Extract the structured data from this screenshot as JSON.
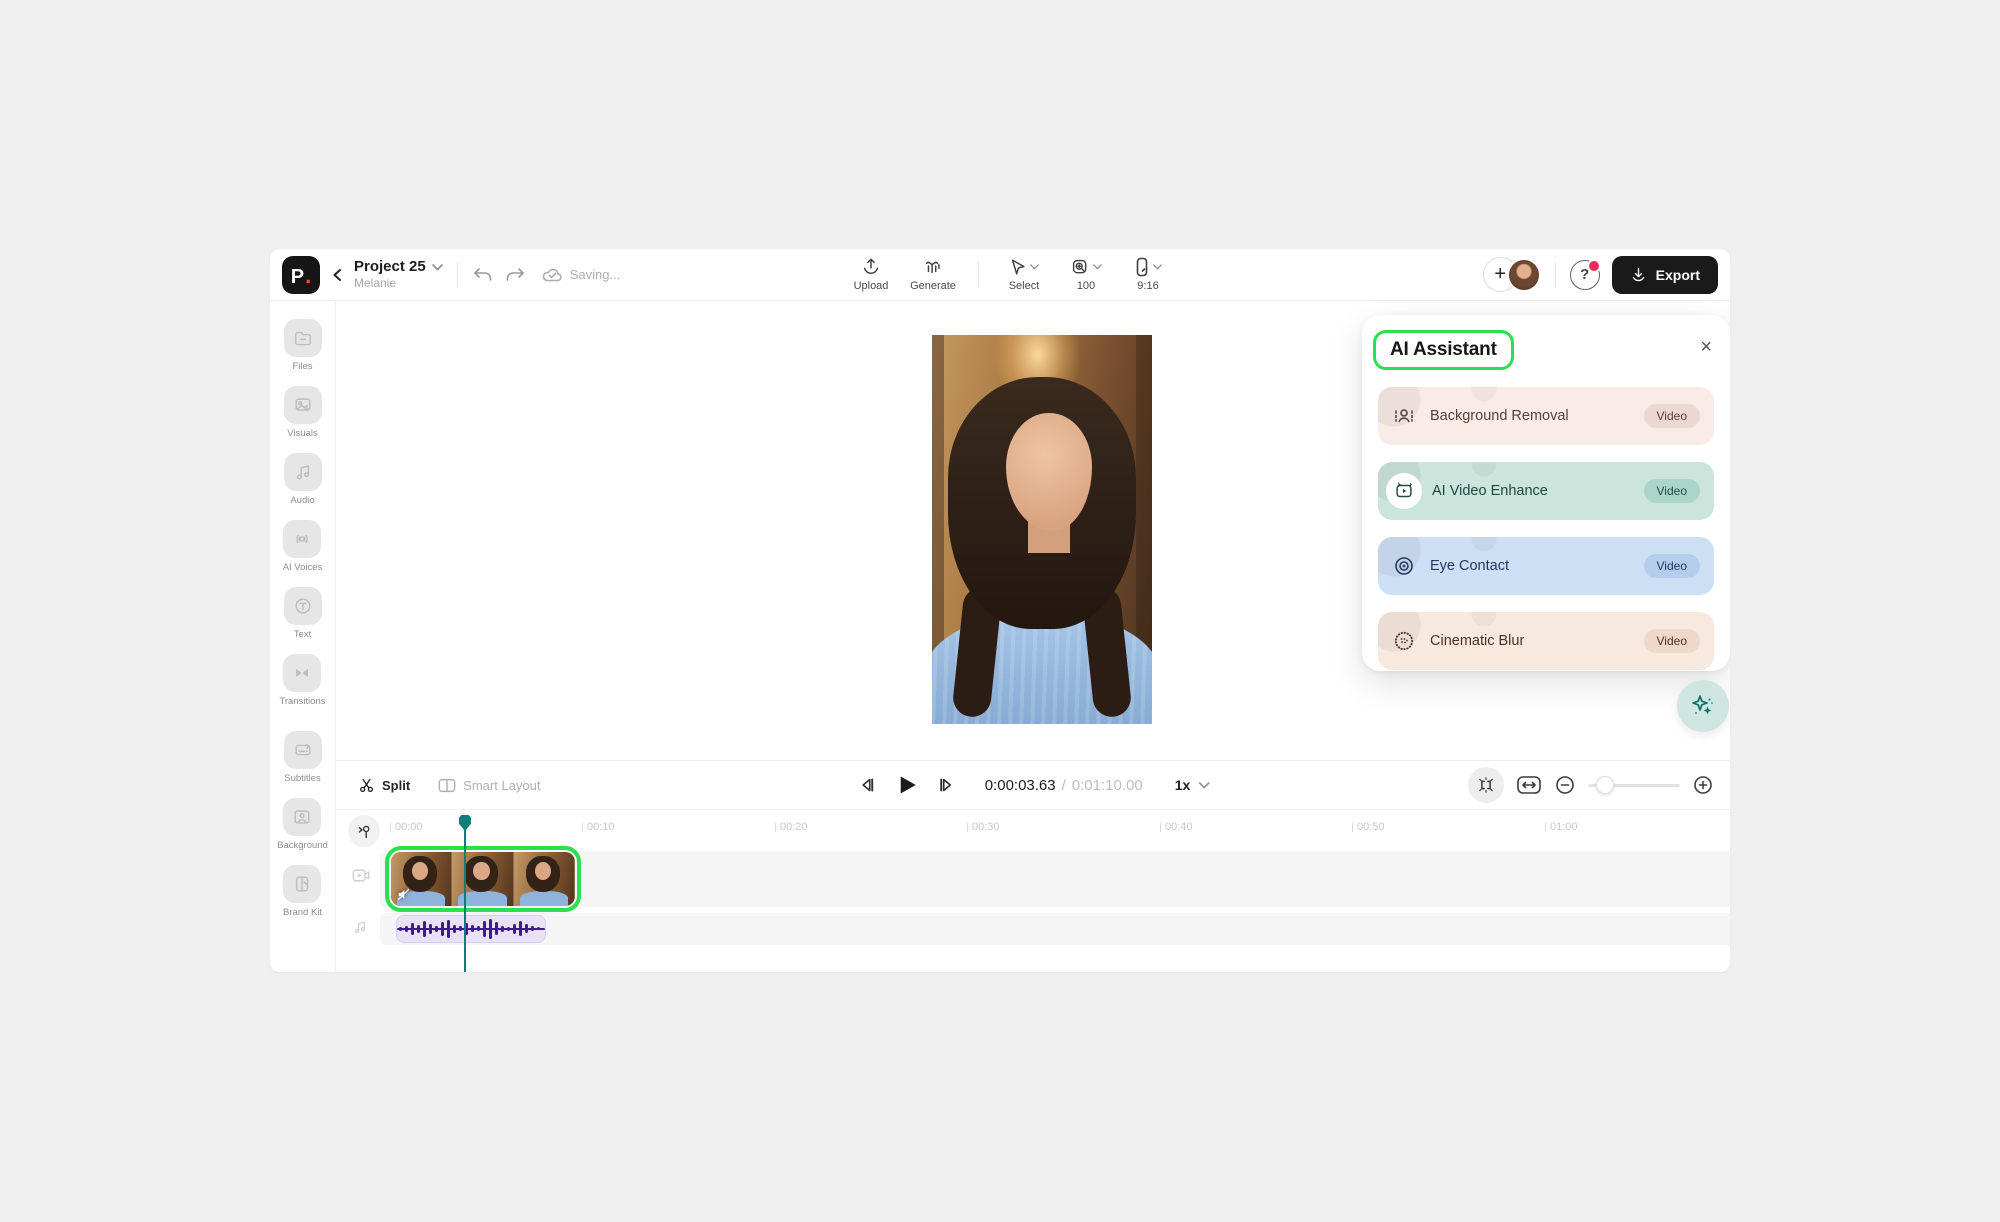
{
  "colors": {
    "page_background": "#efefef",
    "highlight_green": "#2ae04e",
    "playhead_teal": "#0e7f78",
    "waveform_purple": "#3b1b93",
    "export_button_black": "#1a1a1a",
    "notification_red": "#ef2b5e",
    "logo_dot_orange": "#f04f24",
    "card_background_removal_bg": "#f9ebe5",
    "card_ai_video_enhance_bg": "#cbe4dc",
    "card_eye_contact_bg": "#cddff4",
    "card_cinematic_blur_bg": "#f8e9de"
  },
  "header": {
    "logo_text": "P",
    "logo_dot": ".",
    "project_title": "Project 25",
    "project_subtitle": "Melanie",
    "saving_status": "Saving...",
    "tools": [
      {
        "label": "Upload",
        "icon": "upload-icon"
      },
      {
        "label": "Generate",
        "icon": "generate-icon"
      }
    ],
    "view_tools": [
      {
        "label": "Select",
        "icon": "cursor-icon"
      },
      {
        "label": "100",
        "icon": "zoom-magnifier-icon"
      },
      {
        "label": "9:16",
        "icon": "aspect-ratio-phone-icon"
      }
    ],
    "help_label": "?",
    "export_label": "Export"
  },
  "sidebar": {
    "items": [
      {
        "label": "Files",
        "icon": "folder-icon"
      },
      {
        "label": "Visuals",
        "icon": "image-icon"
      },
      {
        "label": "Audio",
        "icon": "music-note-icon"
      },
      {
        "label": "AI Voices",
        "icon": "voice-icon"
      },
      {
        "label": "Text",
        "icon": "text-icon"
      },
      {
        "label": "Transitions",
        "icon": "transitions-icon"
      },
      {
        "label": "Subtitles",
        "icon": "subtitles-icon"
      },
      {
        "label": "Background",
        "icon": "background-icon"
      },
      {
        "label": "Brand Kit",
        "icon": "brand-kit-icon"
      }
    ]
  },
  "assistant_panel": {
    "title": "AI Assistant",
    "close_icon": "×",
    "cards": [
      {
        "label": "Background Removal",
        "badge": "Video",
        "icon": "background-removal-icon"
      },
      {
        "label": "AI Video Enhance",
        "badge": "Video",
        "icon": "ai-video-enhance-icon"
      },
      {
        "label": "Eye Contact",
        "badge": "Video",
        "icon": "eye-contact-icon"
      },
      {
        "label": "Cinematic Blur",
        "badge": "Video",
        "icon": "cinematic-blur-icon"
      }
    ]
  },
  "timeline": {
    "split_label": "Split",
    "smart_layout_label": "Smart Layout",
    "current_time": "0:00:03.63",
    "time_separator": "/",
    "total_time": "0:01:10.00",
    "speed_label": "1x",
    "ruler_ticks": [
      "00:00",
      "00:10",
      "00:20",
      "00:30",
      "00:40",
      "00:50",
      "01:00"
    ]
  }
}
